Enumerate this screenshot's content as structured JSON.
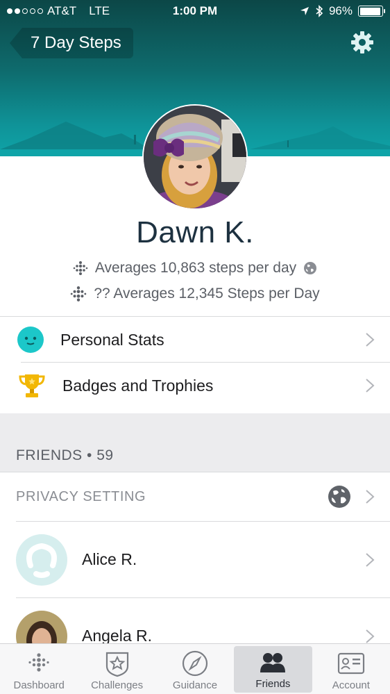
{
  "status_bar": {
    "carrier": "AT&T",
    "network": "LTE",
    "time": "1:00 PM",
    "battery": "96%",
    "battery_level": 0.96
  },
  "header": {
    "back_label": "7 Day Steps",
    "icons": [
      "gear-icon"
    ]
  },
  "profile": {
    "name": "Dawn K.",
    "average_line": "Averages 10,863 steps per day",
    "second_average_line": "?? Averages 12,345 Steps per Day"
  },
  "menu": [
    {
      "label": "Personal Stats",
      "icon": "personal-stats-icon"
    },
    {
      "label": "Badges and Trophies",
      "icon": "trophy-icon"
    }
  ],
  "friends": {
    "header": "FRIENDS • 59",
    "privacy_label": "PRIVACY SETTING",
    "list": [
      {
        "name": "Alice R."
      },
      {
        "name": "Angela R."
      }
    ]
  },
  "tabs": [
    {
      "label": "Dashboard",
      "icon": "dashboard-icon"
    },
    {
      "label": "Challenges",
      "icon": "challenges-icon"
    },
    {
      "label": "Guidance",
      "icon": "compass-icon"
    },
    {
      "label": "Friends",
      "icon": "friends-icon",
      "active": true
    },
    {
      "label": "Account",
      "icon": "account-card-icon"
    }
  ],
  "colors": {
    "header_dark": "#0c4747",
    "header_teal": "#0fa4a8",
    "accent": "#00b0b9",
    "name": "#1d3140"
  }
}
